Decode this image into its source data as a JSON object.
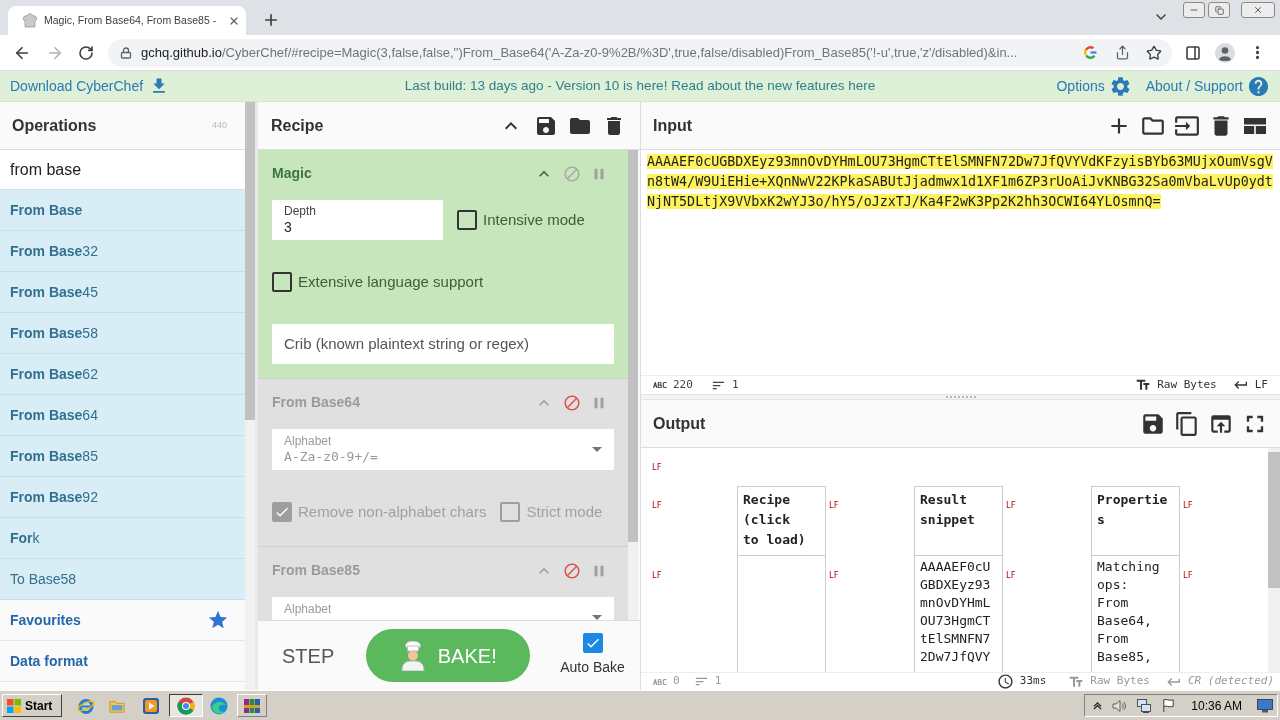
{
  "browser": {
    "tab_title": "Magic, From Base64, From Base85 -",
    "url_host": "gchq.github.io",
    "url_path": "/CyberChef/#recipe=Magic(3,false,false,'')From_Base64('A-Za-z0-9%2B/%3D',true,false/disabled)From_Base85('!-u',true,'z'/disabled)&in..."
  },
  "banner": {
    "download": "Download CyberChef",
    "notice": "Last build: 13 days ago - Version 10 is here! Read about the new features here",
    "options": "Options",
    "about": "About / Support"
  },
  "operations": {
    "title": "Operations",
    "count": "440",
    "search": "from base",
    "results": [
      {
        "label": "**From Base**"
      },
      {
        "label": "**From Base**32"
      },
      {
        "label": "**From Base**45"
      },
      {
        "label": "**From Base**58"
      },
      {
        "label": "**From Base**62"
      },
      {
        "label": "**From Base**64"
      },
      {
        "label": "**From Base**85"
      },
      {
        "label": "**From Base**92"
      },
      {
        "label": "**For**k"
      },
      {
        "label": "To Base58"
      }
    ],
    "categories": [
      {
        "label": "Favourites",
        "kind": "favourites"
      },
      {
        "label": "Data format",
        "kind": "category"
      }
    ]
  },
  "recipe": {
    "title": "Recipe",
    "ops": [
      {
        "name": "Magic",
        "disabled": false,
        "args": [
          {
            "kind": "number",
            "label": "Depth",
            "value": "3"
          },
          {
            "kind": "checkbox",
            "label": "Intensive mode",
            "checked": false
          },
          {
            "kind": "checkbox",
            "label": "Extensive language support",
            "checked": false
          },
          {
            "kind": "text",
            "placeholder": "Crib (known plaintext string or regex)"
          }
        ]
      },
      {
        "name": "From Base64",
        "disabled": true,
        "args": [
          {
            "kind": "dropdown",
            "label": "Alphabet",
            "value": "A-Za-z0-9+/="
          },
          {
            "kind": "checkbox",
            "label": "Remove non-alphabet chars",
            "checked": true
          },
          {
            "kind": "checkbox",
            "label": "Strict mode",
            "checked": false
          }
        ]
      },
      {
        "name": "From Base85",
        "disabled": true,
        "args": [
          {
            "kind": "dropdown",
            "label": "Alphabet"
          }
        ]
      }
    ],
    "step": "STEP",
    "bake": "BAKE!",
    "auto_bake": {
      "label": "Auto Bake",
      "checked": true
    }
  },
  "input": {
    "title": "Input",
    "text": "AAAAEF0cUGBDXEyz93mnOvDYHmLOU73HgmCTtElSMNFN72Dw7JfQVYVdKFzyisBYb63MUjxOumVsgVn8tW4/W9UiEHie+XQnNwV22KPkaSABUtJjadmwx1d1XF1m6ZP3rUoAiJvKNBG32Sa0mVbaLvUp0ydtNjNT5DLtjX9VVbxK2wYJ3o/hY5/oJzxTJ/Ka4F2wK3Pp2K2hh3OCWI64YLOsmnQ=",
    "highlighted": true,
    "status": {
      "length": "220",
      "lines": "1",
      "format": "Raw Bytes",
      "eol": "LF"
    }
  },
  "output": {
    "title": "Output",
    "rows": [
      {
        "items": [
          {
            "kind": "eol",
            "text": "LF"
          }
        ]
      },
      {
        "items": [
          {
            "kind": "eol",
            "text": "LF"
          },
          {
            "kind": "header",
            "lines": [
              "Recipe",
              "(click",
              "to load)"
            ]
          },
          {
            "kind": "eol",
            "text": "LF"
          },
          {
            "kind": "header",
            "lines": [
              "Result",
              "snippet"
            ]
          },
          {
            "kind": "eol",
            "text": "LF"
          },
          {
            "kind": "header",
            "lines": [
              "Propertie",
              "s"
            ]
          },
          {
            "kind": "eol",
            "text": "LF"
          }
        ]
      },
      {
        "items": [
          {
            "kind": "eol",
            "text": "LF"
          },
          {
            "kind": "cell"
          },
          {
            "kind": "eol",
            "text": "LF"
          },
          {
            "kind": "cell",
            "lines": [
              "AAAAEF0cU",
              "GBDXEyz93",
              "mnOvDYHmL",
              "OU73HgmCT",
              "tElSMNFN7",
              "2Dw7JfQVY"
            ]
          },
          {
            "kind": "eol",
            "text": "LF"
          },
          {
            "kind": "cell",
            "lines": [
              "Matching",
              "ops:",
              "From",
              "Base64,",
              "From",
              "Base85,"
            ]
          },
          {
            "kind": "eol",
            "text": "LF"
          }
        ]
      }
    ],
    "status": {
      "length": "0",
      "lines": "1",
      "time": "33ms",
      "format": "Raw Bytes",
      "eol": "CR (detected)"
    }
  },
  "taskbar": {
    "start": "Start",
    "clock": "10:36 AM"
  }
}
